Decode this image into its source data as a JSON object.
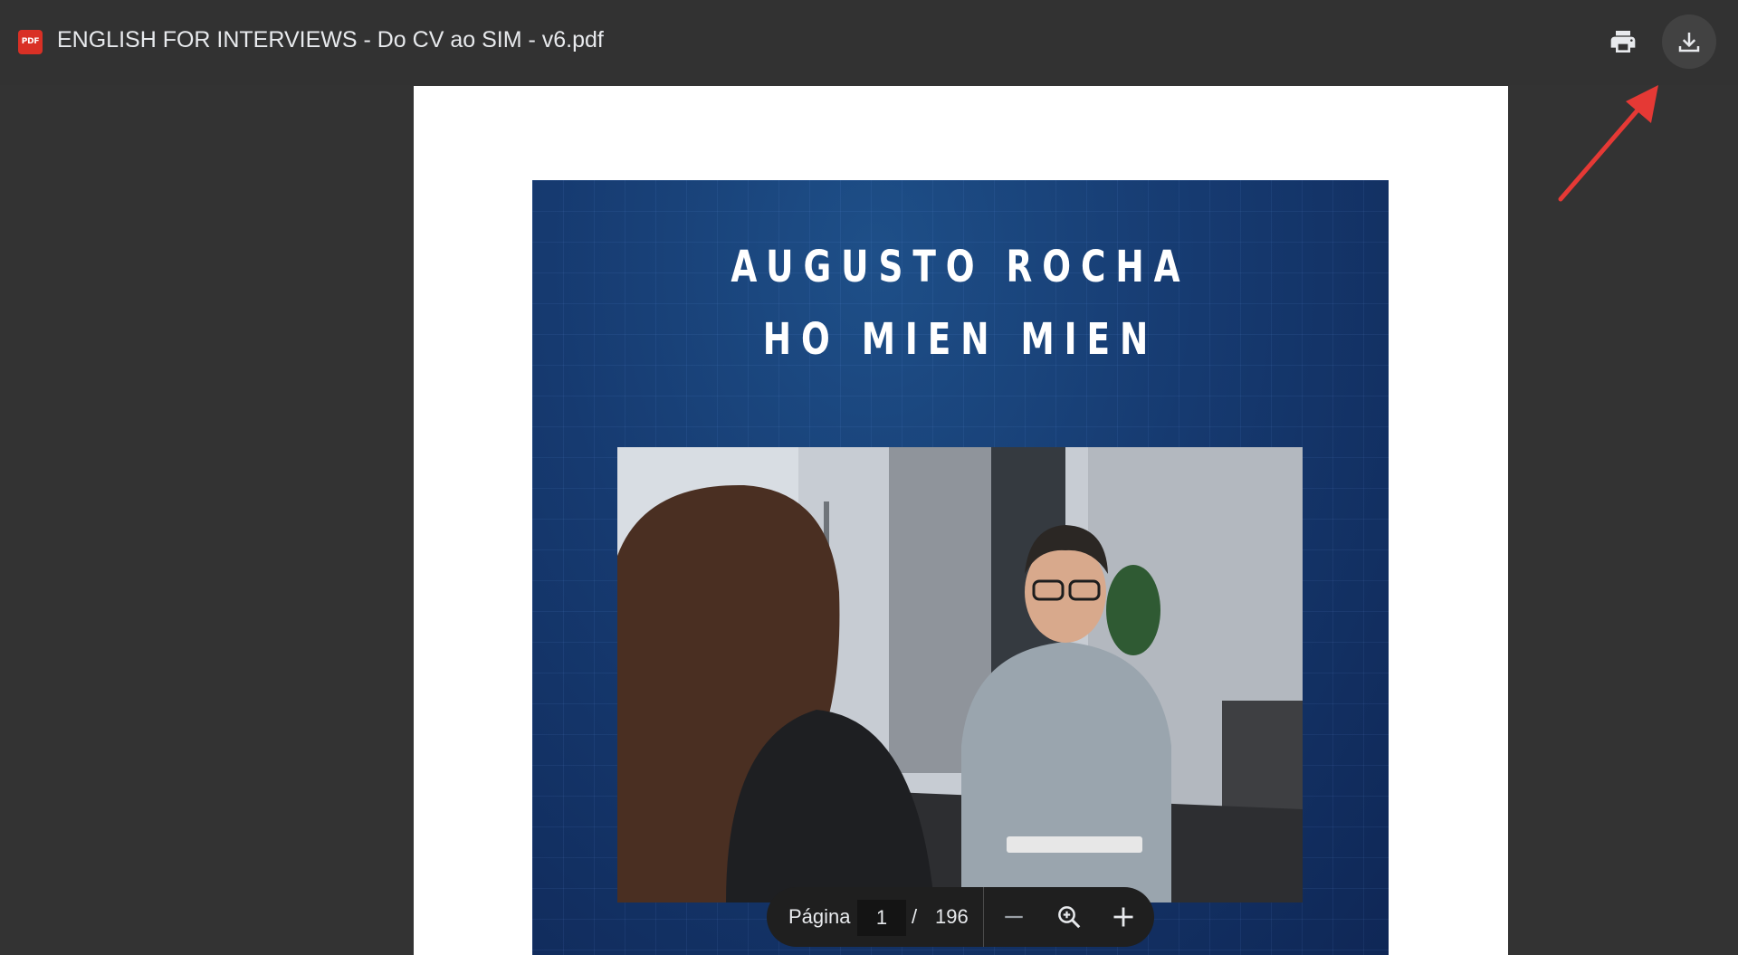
{
  "header": {
    "file_type_label": "PDF",
    "title": "ENGLISH FOR INTERVIEWS - Do CV ao SIM - v6.pdf",
    "icons": [
      "pdf-file-icon",
      "print-icon",
      "download-icon"
    ]
  },
  "document": {
    "cover_line1": "AUGUSTO ROCHA",
    "cover_line2": "HO MIEN MIEN"
  },
  "toolbar": {
    "page_label": "Página",
    "current_page": "1",
    "separator": "/",
    "total_pages": "196",
    "icons": [
      "zoom-out-icon",
      "zoom-icon",
      "zoom-in-icon"
    ]
  },
  "colors": {
    "background": "#333333",
    "accent_pdf": "#d93025",
    "annotation_arrow": "#e53935",
    "cover_blue": "#163a70"
  }
}
